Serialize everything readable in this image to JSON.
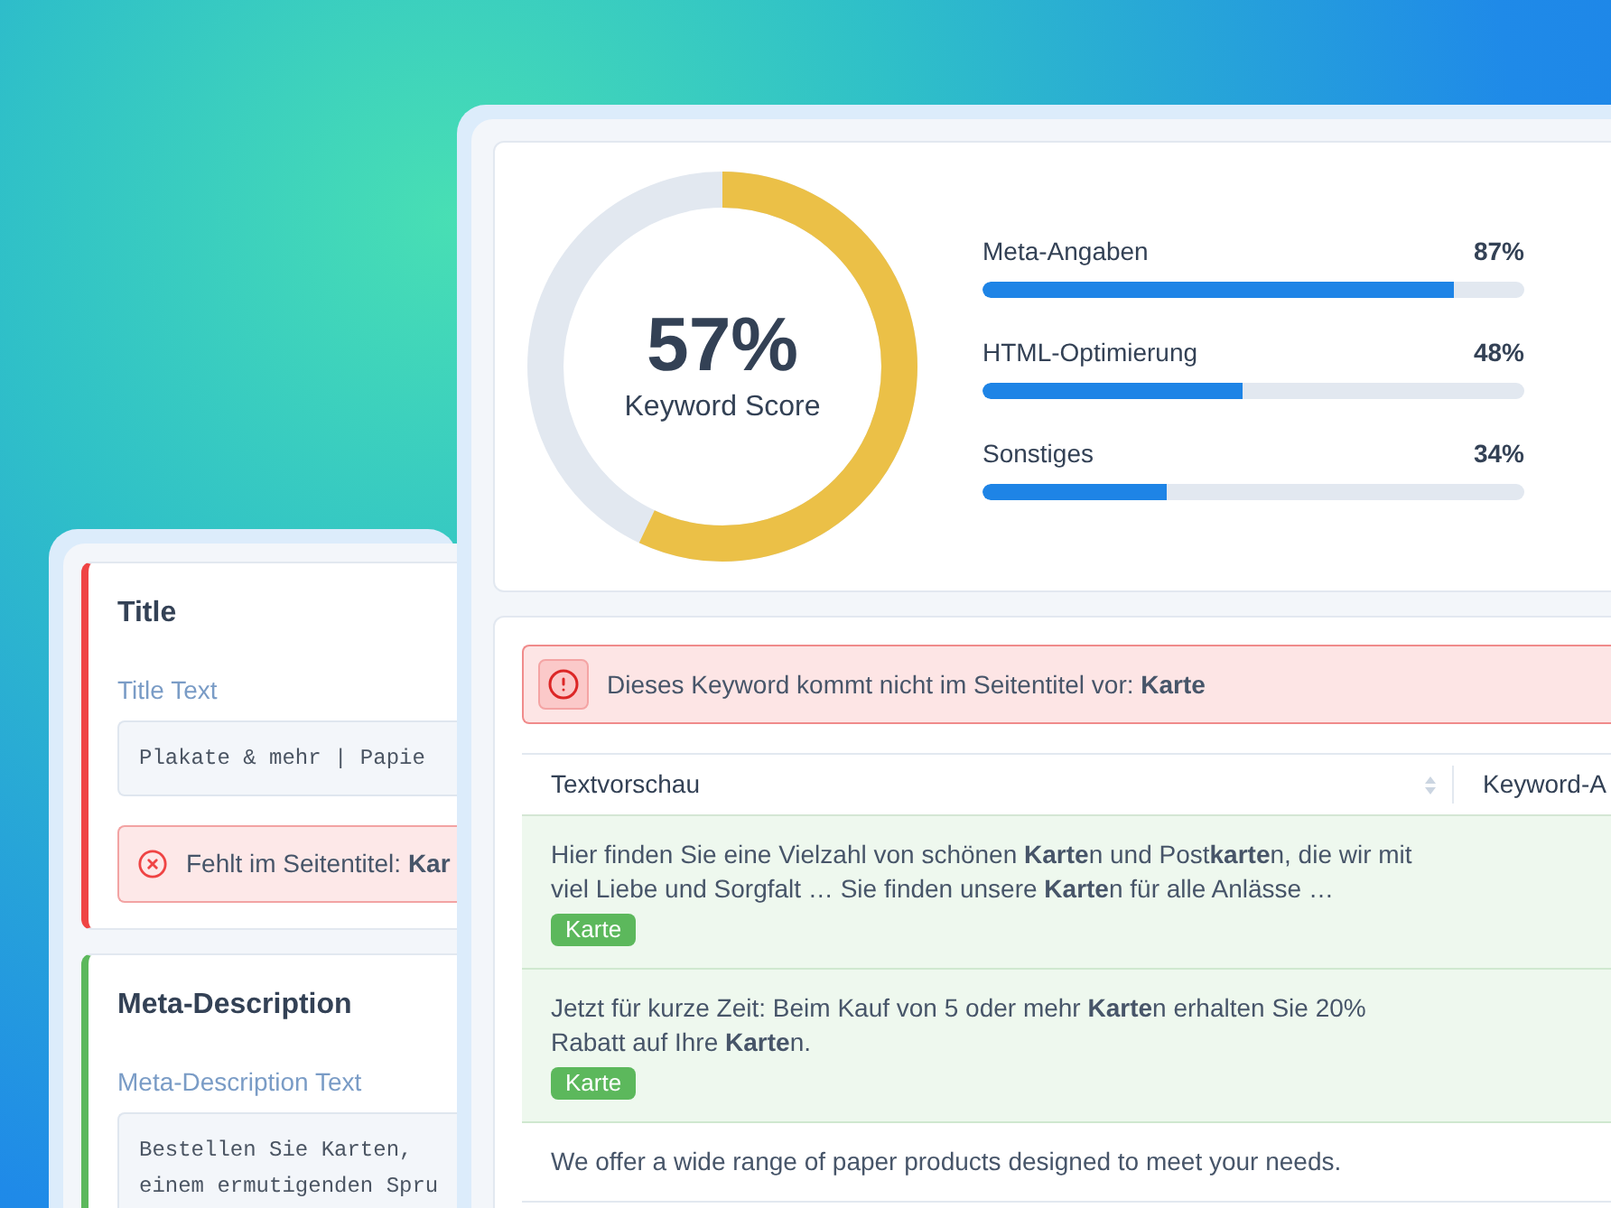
{
  "back_panel": {
    "sections": [
      {
        "title": "Title",
        "error": true,
        "field_label": "Title Text",
        "value": "Plakate & mehr | Papie",
        "message": "Fehlt im Seitentitel: **Kar**"
      },
      {
        "title": "Meta-Description",
        "error": false,
        "field_label": "Meta-Description Text",
        "value": "Bestellen Sie Karten, \neinem ermutigenden Spru"
      }
    ]
  },
  "score": {
    "value": "57%",
    "label": "Keyword Score",
    "level": 0.57,
    "categories": [
      {
        "name": "Meta-Angaben",
        "reading": "87%",
        "level": 0.87
      },
      {
        "name": "HTML-Optimierung",
        "reading": "48%",
        "level": 0.48
      },
      {
        "name": "Sonstiges",
        "reading": "34%",
        "level": 0.34
      }
    ]
  },
  "alert": {
    "text": "Dieses Keyword kommt nicht im Seitentitel vor: **Karte**"
  },
  "table": {
    "columns": [
      "Textvorschau",
      "Keyword-A"
    ],
    "rows": [
      {
        "text": "Hier finden Sie eine Vielzahl von schönen **Karte**n und Post**karte**n, die wir mit viel Liebe und Sorgfalt … Sie finden unsere **Karte**n für alle Anlässe …",
        "matched": true,
        "tag": "Karte"
      },
      {
        "text": "Jetzt für kurze Zeit: Beim Kauf von 5 oder mehr **Karte**n erhalten Sie 20% Rabatt auf Ihre **Karte**n.",
        "matched": true,
        "tag": "Karte"
      },
      {
        "text": "We offer a wide range of paper products designed to meet your needs.",
        "matched": false
      }
    ]
  }
}
